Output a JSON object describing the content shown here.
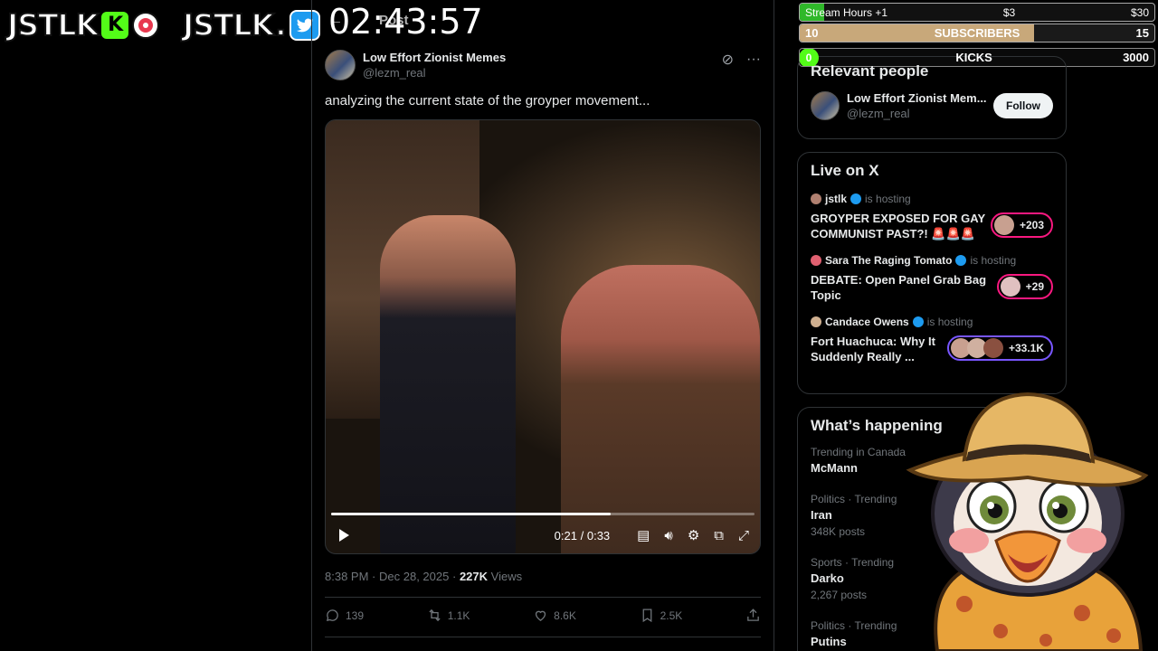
{
  "overlay": {
    "brand1": "JSTLK",
    "brand2": "JSTLK",
    "brand2_suffix": ".",
    "kick_letter": "K",
    "timer": "02:43:57",
    "ghost_back": "←",
    "ghost_title": "Post"
  },
  "goals": {
    "row1": {
      "label": "Stream Hours +1",
      "mid": "$3",
      "right": "$30",
      "progress": 0.07
    },
    "row2": {
      "left": "10",
      "label": "SUBSCRIBERS",
      "right": "15",
      "progress": 0.66
    },
    "row3": {
      "left": "0",
      "label": "KICKS",
      "right": "3000",
      "progress": 0.0
    }
  },
  "tweet": {
    "display_name": "Low Effort Zionist Memes",
    "handle": "@lezm_real",
    "text": "analyzing the current state of the groyper movement...",
    "video": {
      "current": "0:21",
      "sep": "/",
      "duration": "0:33",
      "progress": 0.66
    },
    "time": "8:38 PM",
    "date": "Dec 28, 2025",
    "views_count": "227K",
    "views_label": "Views",
    "dot": "·",
    "actions": {
      "replies": "139",
      "reposts": "1.1K",
      "likes": "8.6K",
      "bookmarks": "2.5K"
    }
  },
  "sidebar": {
    "relevant_title": "Relevant people",
    "relevant_name": "Low Effort Zionist Mem...",
    "relevant_handle": "@lezm_real",
    "follow_label": "Follow",
    "live_title": "Live on X",
    "live_items": [
      {
        "host": "jstlk",
        "hosting": "is hosting",
        "title": "GROYPER EXPOSED FOR GAY COMMUNIST PAST?! 🚨🚨🚨",
        "count": "+203"
      },
      {
        "host": "Sara The Raging Tomato",
        "hosting": "is hosting",
        "title": "DEBATE: Open Panel Grab Bag Topic",
        "count": "+29"
      },
      {
        "host": "Candace Owens",
        "hosting": "is hosting",
        "title": "Fort Huachuca: Why It Suddenly Really ...",
        "count": "+33.1K"
      }
    ],
    "happening_title": "What’s happening",
    "trends": [
      {
        "category": "Trending in Canada",
        "name": "McMann",
        "posts": ""
      },
      {
        "category": "Politics · Trending",
        "name": "Iran",
        "posts": "348K posts"
      },
      {
        "category": "Sports · Trending",
        "name": "Darko",
        "posts": "2,267 posts"
      },
      {
        "category": "Politics · Trending",
        "name": "Putins",
        "posts": ""
      }
    ]
  },
  "colors": {
    "accent": "#1d9bf0",
    "kick_green": "#53fc18",
    "live_pink": "#f91880",
    "live_purple": "#7856ff"
  }
}
